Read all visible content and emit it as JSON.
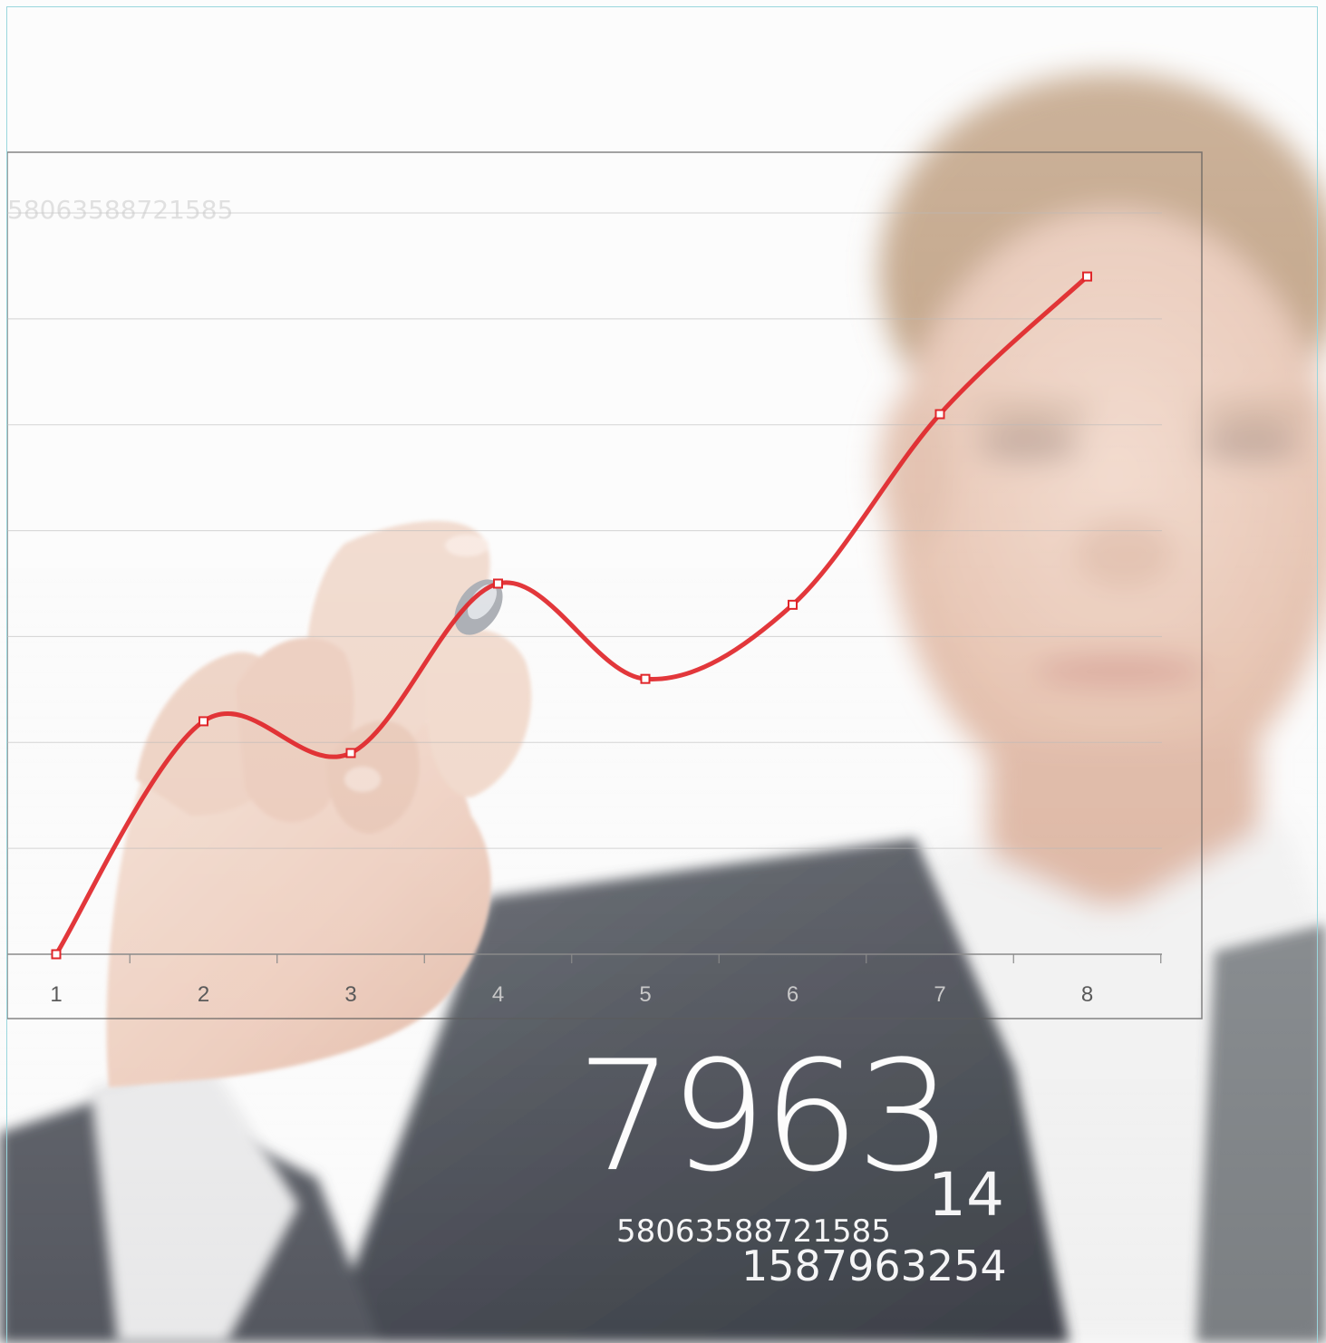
{
  "scene": {
    "description_colors": {
      "background": "#fbfbfb",
      "suit": "#4b4f57",
      "skin": "#e7c7b5",
      "hair": "#b08a64",
      "line": "#e0262a",
      "grid": "#b9b9b9"
    }
  },
  "chart_data": {
    "type": "line",
    "x": [
      1,
      2,
      3,
      4,
      5,
      6,
      7,
      8
    ],
    "categories": [
      "1",
      "2",
      "3",
      "4",
      "5",
      "6",
      "7",
      "8"
    ],
    "values": [
      0,
      2.2,
      1.9,
      3.5,
      2.6,
      3.3,
      5.1,
      6.4
    ],
    "smooth": true,
    "grid": true,
    "color": "#e0262a",
    "title": "",
    "xlabel": "",
    "ylabel": ""
  },
  "overlay": {
    "big_number": "7963",
    "faded_top_number": "58063588721585",
    "small_number_14": "14",
    "number_line_1": "58063588721585",
    "number_line_2": "1587963254"
  }
}
